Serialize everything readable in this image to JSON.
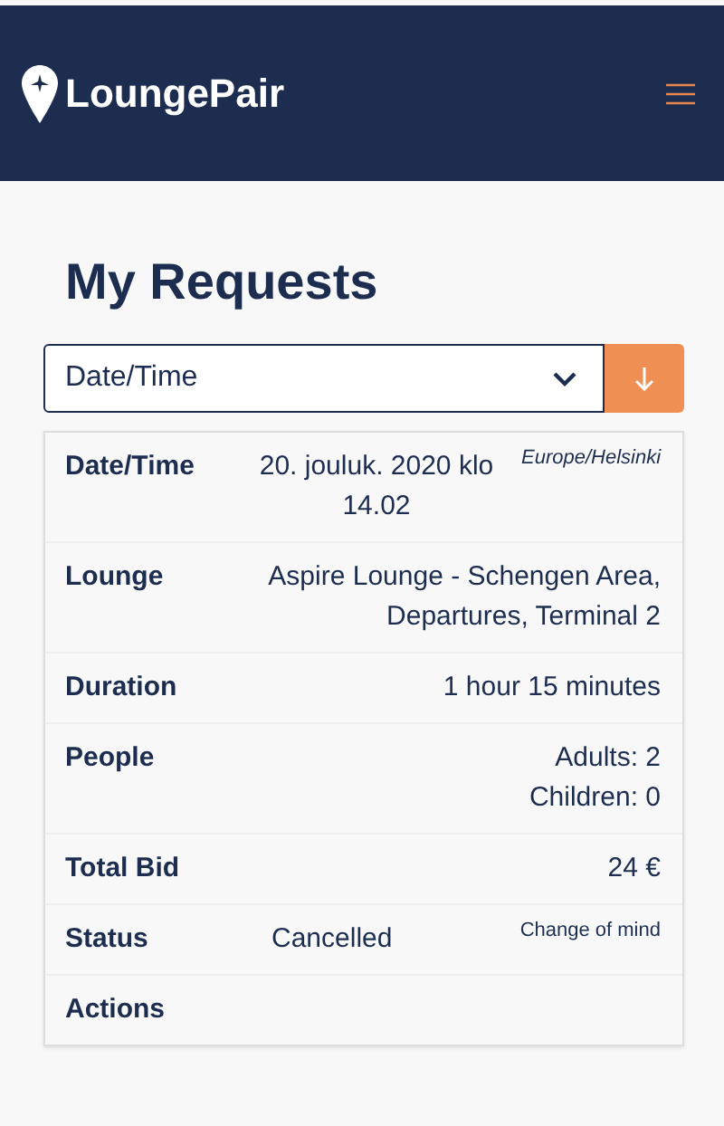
{
  "header": {
    "logo_text": "LoungePair"
  },
  "title": "My Requests",
  "sort": {
    "value": "Date/Time"
  },
  "request": {
    "rows": [
      {
        "kind": "datetime",
        "label": "Date/Time",
        "value": "20. jouluk. 2020 klo 14.02",
        "timezone": "Europe/Helsinki"
      },
      {
        "kind": "text",
        "label": "Lounge",
        "value": "Aspire Lounge - Schengen Area, Departures, Terminal 2"
      },
      {
        "kind": "text",
        "label": "Duration",
        "value": "1 hour 15 minutes"
      },
      {
        "kind": "lines",
        "label": "People",
        "lines": [
          "Adults: 2",
          "Children: 0"
        ]
      },
      {
        "kind": "text",
        "label": "Total Bid",
        "value": "24 €"
      },
      {
        "kind": "status",
        "label": "Status",
        "value": "Cancelled",
        "reason": "Change of mind"
      },
      {
        "kind": "empty",
        "label": "Actions"
      }
    ]
  }
}
